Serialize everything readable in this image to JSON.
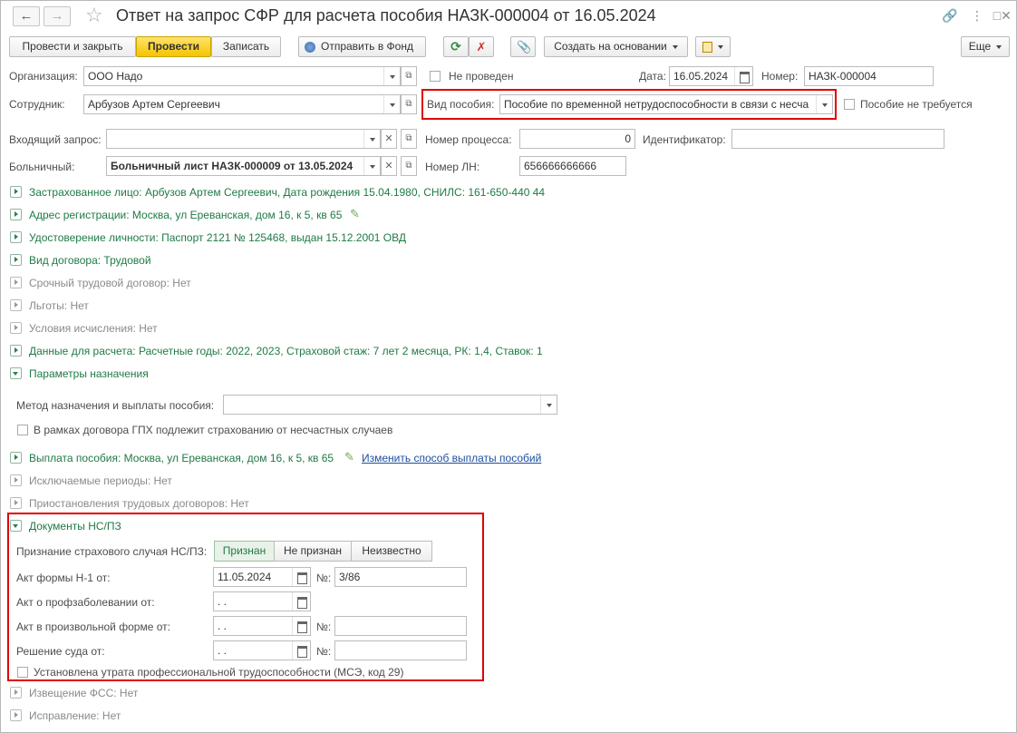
{
  "window": {
    "title": "Ответ на запрос СФР для расчета пособия НАЗК-000004 от 16.05.2024"
  },
  "toolbar": {
    "post_close": "Провести и закрыть",
    "post": "Провести",
    "save": "Записать",
    "send_fund": "Отправить в Фонд",
    "create_based": "Создать на основании",
    "more": "Еще"
  },
  "header": {
    "org_label": "Организация:",
    "org_value": "ООО Надо",
    "not_posted": "Не проведен",
    "date_label": "Дата:",
    "date_value": "16.05.2024",
    "number_label": "Номер:",
    "number_value": "НАЗК-000004",
    "employee_label": "Сотрудник:",
    "employee_value": "Арбузов Артем Сергеевич",
    "benefit_label": "Вид пособия:",
    "benefit_value": "Пособие по временной нетрудоспособности в связи с несча",
    "benefit_not_required": "Пособие не требуется",
    "request_label": "Входящий запрос:",
    "request_value": "",
    "process_label": "Номер процесса:",
    "process_value": "0",
    "ident_label": "Идентификатор:",
    "ident_value": "",
    "sick_label": "Больничный:",
    "sick_value": "Больничный лист НАЗК-000009 от 13.05.2024",
    "ln_label": "Номер ЛН:",
    "ln_value": "656666666666"
  },
  "groups": [
    {
      "text": "Застрахованное лицо: Арбузов Артем Сергеевич, Дата рождения 15.04.1980, СНИЛС: 161-650-440 44"
    },
    {
      "text": "Адрес регистрации: Москва, ул Ереванская, дом 16, к 5, кв 65"
    },
    {
      "text": "Удостоверение личности: Паспорт 2121 № 125468, выдан 15.12.2001 ОВД"
    },
    {
      "text": "Вид договора: Трудовой"
    },
    {
      "text": "Срочный трудовой договор: Нет"
    },
    {
      "text": "Льготы: Нет"
    },
    {
      "text": "Условия исчисления: Нет"
    },
    {
      "text": "Данные для расчета: Расчетные годы: 2022, 2023, Страховой стаж: 7 лет 2 месяца, РК: 1,4, Ставок: 1"
    },
    {
      "text": "Параметры назначения"
    },
    {
      "text": "Выплата пособия: Москва, ул Ереванская, дом 16, к 5, кв 65"
    },
    {
      "text": "Исключаемые периоды: Нет"
    },
    {
      "text": "Приостановления трудовых договоров: Нет"
    },
    {
      "text": "Документы НС/ПЗ"
    },
    {
      "text": "Извещение ФСС: Нет"
    },
    {
      "text": "Исправление: Нет"
    }
  ],
  "params": {
    "method_label": "Метод назначения и выплаты пособия:",
    "method_value": "",
    "gph_label": "В рамках договора ГПХ подлежит страхованию от несчастных случаев"
  },
  "payment": {
    "change_link": "Изменить способ выплаты пособий"
  },
  "ns": {
    "recognition_label": "Признание страхового случая НС/ПЗ:",
    "opt_yes": "Признан",
    "opt_no": "Не признан",
    "opt_unknown": "Неизвестно",
    "n1_label": "Акт формы Н-1 от:",
    "n1_date": "11.05.2024",
    "num_label": "№:",
    "n1_num": "3/86",
    "prof_label": "Акт о профзаболевании от:",
    "prof_date": " .  .",
    "free_label": "Акт в произвольной форме от:",
    "free_date": " .  .",
    "free_num": "",
    "court_label": "Решение суда от:",
    "court_date": " .  .",
    "court_num": "",
    "mse_label": "Установлена утрата профессиональной трудоспособности (МСЭ, код 29)"
  }
}
